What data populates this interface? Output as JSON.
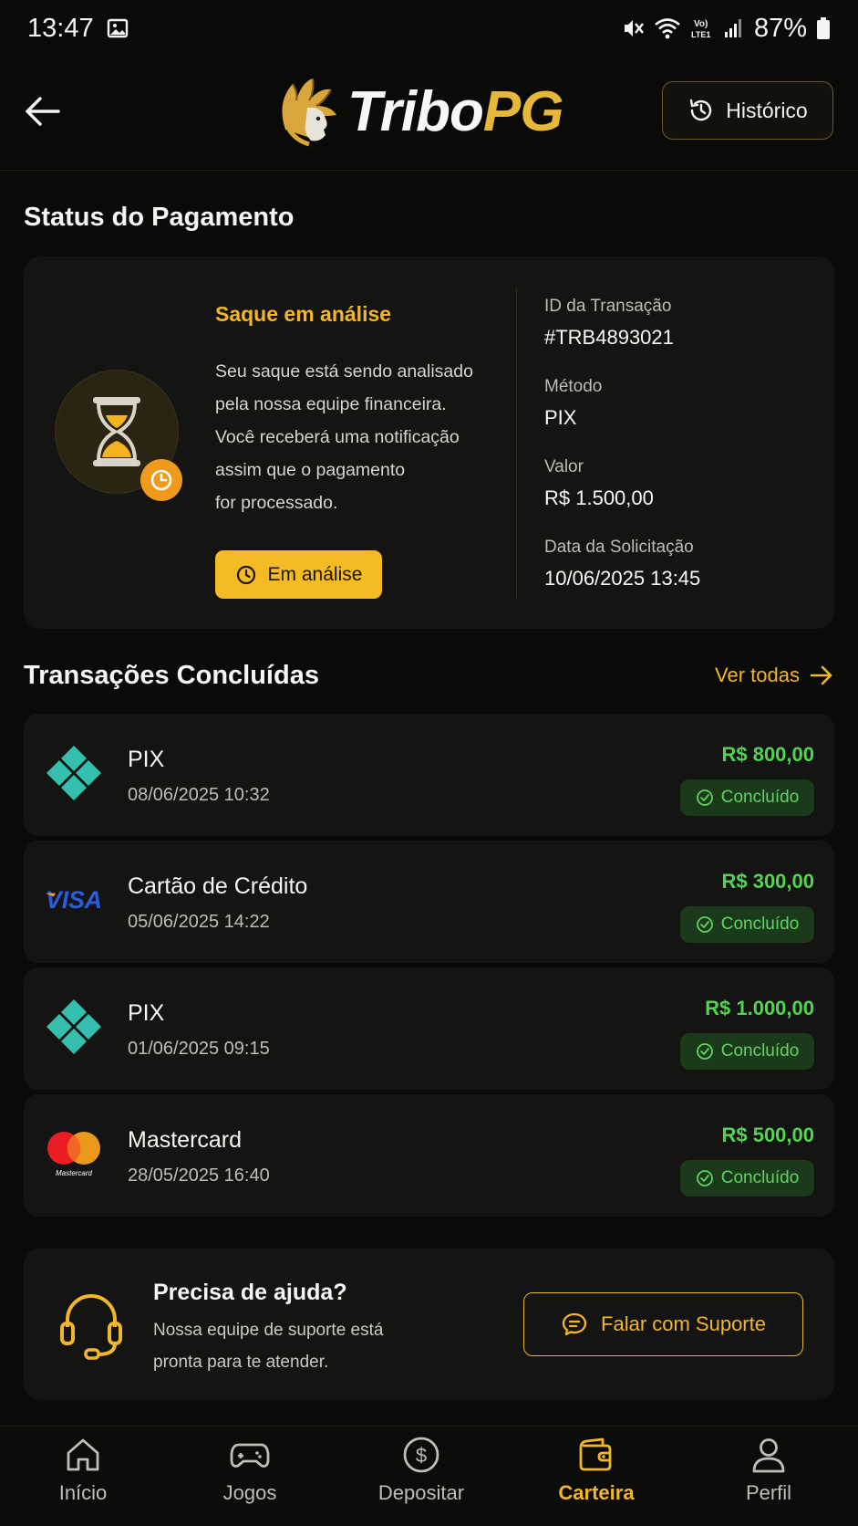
{
  "status_bar": {
    "time": "13:47",
    "battery": "87%"
  },
  "header": {
    "logo_part1": "Tribo",
    "logo_part2": "PG",
    "history_label": "Histórico"
  },
  "payment_status": {
    "section_title": "Status do Pagamento",
    "status_title": "Saque em análise",
    "description_lines": [
      "Seu saque está sendo analisado",
      "pela nossa equipe financeira.",
      "Você receberá uma notificação",
      "assim que o pagamento",
      "for processado."
    ],
    "status_button": "Em análise",
    "info": [
      {
        "label": "ID da Transação",
        "value": "#TRB4893021"
      },
      {
        "label": "Método",
        "value": "PIX"
      },
      {
        "label": "Valor",
        "value": "R$ 1.500,00"
      },
      {
        "label": "Data da Solicitação",
        "value": "10/06/2025 13:45"
      }
    ]
  },
  "transactions": {
    "section_title": "Transações Concluídas",
    "see_all": "Ver todas",
    "items": [
      {
        "name": "PIX",
        "date": "08/06/2025 10:32",
        "amount": "R$ 800,00",
        "status": "Concluído",
        "icon": "pix-icon"
      },
      {
        "name": "Cartão de Crédito",
        "date": "05/06/2025 14:22",
        "amount": "R$ 300,00",
        "status": "Concluído",
        "icon": "visa-icon"
      },
      {
        "name": "PIX",
        "date": "01/06/2025 09:15",
        "amount": "R$ 1.000,00",
        "status": "Concluído",
        "icon": "pix-icon"
      },
      {
        "name": "Mastercard",
        "date": "28/05/2025 16:40",
        "amount": "R$ 500,00",
        "status": "Concluído",
        "icon": "mastercard-icon"
      }
    ],
    "visa_text": "VISA",
    "mastercard_text": "Mastercard"
  },
  "help": {
    "title": "Precisa de ajuda?",
    "description_lines": [
      "Nossa equipe de suporte está",
      "pronta para te atender."
    ],
    "button_label": "Falar com Suporte"
  },
  "bottom_nav": {
    "items": [
      {
        "label": "Início",
        "icon": "home-icon"
      },
      {
        "label": "Jogos",
        "icon": "gamepad-icon"
      },
      {
        "label": "Depositar",
        "icon": "dollar-icon"
      },
      {
        "label": "Carteira",
        "icon": "wallet-icon",
        "active": true
      },
      {
        "label": "Perfil",
        "icon": "user-icon"
      }
    ]
  },
  "colors": {
    "accent": "#f2b62a",
    "success": "#52d452",
    "background": "#0a0a09",
    "card": "#141412"
  }
}
